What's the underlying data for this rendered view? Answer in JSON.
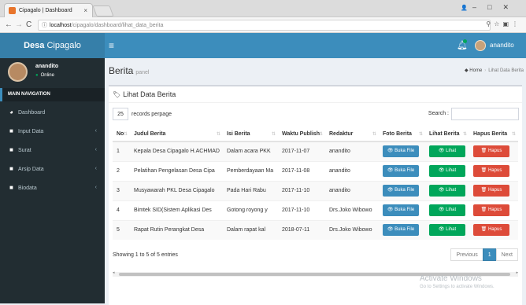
{
  "browser": {
    "tab_title": "Cipagalo | Dashboard",
    "tab_close": "×",
    "url_host": "localhost",
    "url_path": "/cipagalo/dashboard/lihat_data_berita"
  },
  "header": {
    "logo_bold": "Desa",
    "logo_rest": " Cipagalo",
    "user_name": "anandito"
  },
  "sidebar": {
    "user_name": "anandito",
    "status": "Online",
    "nav_header": "MAIN NAVIGATION",
    "items": [
      {
        "label": "Dashboard",
        "icon": "dashboard-icon"
      },
      {
        "label": "Input Data",
        "icon": "folder-icon"
      },
      {
        "label": "Surat",
        "icon": "folder-icon"
      },
      {
        "label": "Arsip Data",
        "icon": "folder-icon"
      },
      {
        "label": "Biodata",
        "icon": "folder-icon"
      }
    ]
  },
  "page": {
    "title": "Berita",
    "subtitle": "panel",
    "breadcrumb_home": "Home",
    "breadcrumb_current": "Lihat Data Berita"
  },
  "box": {
    "title": "Lihat Data Berita",
    "length_value": "25",
    "length_label": "records perpage",
    "search_label": "Search :"
  },
  "table": {
    "headers": [
      "No",
      "Judul Berita",
      "Isi Berita",
      "Waktu Publish",
      "Redaktur",
      "Foto Berita",
      "Lihat Berita",
      "Hapus Berita"
    ],
    "rows": [
      {
        "no": "1",
        "judul": "Kepala Desa Cipagalo H.ACHMAD",
        "isi": "Dalam acara PKK",
        "waktu": "2017-11-07",
        "redaktur": "anandito"
      },
      {
        "no": "2",
        "judul": "Pelatihan Pengelasan Desa Cipa",
        "isi": "Pemberdayaan Ma",
        "waktu": "2017-11-08",
        "redaktur": "anandito"
      },
      {
        "no": "3",
        "judul": "Musyawarah PKL Desa Cipagalo",
        "isi": "Pada Hari Rabu",
        "waktu": "2017-11-10",
        "redaktur": "anandito"
      },
      {
        "no": "4",
        "judul": "Bimtek SID(Sistem Aplikasi Des",
        "isi": "Gotong royong y",
        "waktu": "2017-11-10",
        "redaktur": "Drs.Joko Wibowo"
      },
      {
        "no": "5",
        "judul": "Rapat Rutin Perangkat Desa",
        "isi": "Dalam rapat kal",
        "waktu": "2018-07-11",
        "redaktur": "Drs.Joko Wibowo"
      }
    ],
    "btn_foto": "Buka File",
    "btn_lihat": "Lihat",
    "btn_hapus": "Hapus"
  },
  "footer_info": {
    "entries": "Showing 1 to 5 of 5 entries",
    "prev": "Previous",
    "page": "1",
    "next": "Next"
  },
  "watermark": {
    "line1": "Activate Windows",
    "line2": "Go to Settings to activate Windows."
  },
  "colors": {
    "primary": "#3c8dbc",
    "success": "#00a65a",
    "danger": "#dd4b39",
    "sidebar": "#222d32"
  }
}
